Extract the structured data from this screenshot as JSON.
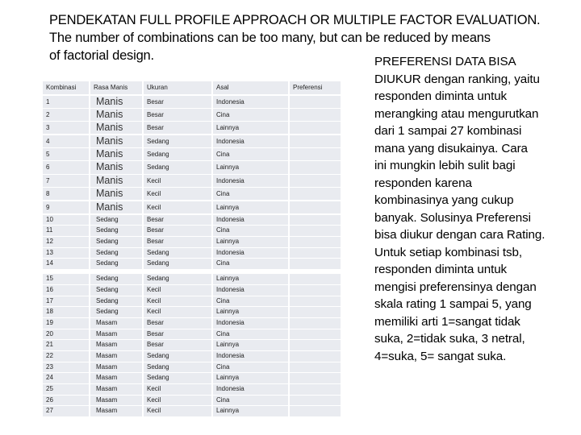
{
  "heading": {
    "lines": [
      "PENDEKATAN FULL PROFILE APPROACH OR MULTIPLE FACTOR EVALUATION.",
      "The number of combinations can be too many, but can be reduced by means",
      "of factorial design."
    ]
  },
  "description": {
    "lines": [
      "PREFERENSI DATA BISA",
      "DIUKUR dengan ranking, yaitu",
      "responden diminta untuk",
      "merangking atau mengurutkan",
      "dari 1 sampai 27 kombinasi",
      "mana yang disukainya.   Cara",
      "ini mungkin lebih sulit bagi",
      "responden karena",
      "kombinasinya yang cukup",
      "banyak. Solusinya Preferensi",
      "bisa diukur dengan cara Rating.",
      "Untuk setiap kombinasi tsb,",
      "responden diminta untuk",
      "mengisi preferensinya dengan",
      "skala rating 1 sampai 5, yang",
      "memiliki arti 1=sangat tidak",
      "suka, 2=tidak suka, 3 netral,",
      "4=suka, 5= sangat suka."
    ]
  },
  "table": {
    "headers": [
      "Kombinasi",
      "Rasa Manis",
      "Ukuran",
      "Asal",
      "Preferensi"
    ],
    "rows": [
      [
        "1",
        "Manis",
        "Besar",
        "Indonesia",
        ""
      ],
      [
        "2",
        "Manis",
        "Besar",
        "Cina",
        ""
      ],
      [
        "3",
        "Manis",
        "Besar",
        "Lainnya",
        ""
      ],
      [
        "4",
        "Manis",
        "Sedang",
        "Indonesia",
        ""
      ],
      [
        "5",
        "Manis",
        "Sedang",
        "Cina",
        ""
      ],
      [
        "6",
        "Manis",
        "Sedang",
        "Lainnya",
        ""
      ],
      [
        "7",
        "Manis",
        "Kecil",
        "Indonesia",
        ""
      ],
      [
        "8",
        "Manis",
        "Kecil",
        "Cina",
        ""
      ],
      [
        "9",
        "Manis",
        "Kecil",
        "Lainnya",
        ""
      ],
      [
        "10",
        "Sedang",
        "Besar",
        "Indonesia",
        ""
      ],
      [
        "11",
        "Sedang",
        "Besar",
        "Cina",
        ""
      ],
      [
        "12",
        "Sedang",
        "Besar",
        "Lainnya",
        ""
      ],
      [
        "13",
        "Sedang",
        "Sedang",
        "Indonesia",
        ""
      ],
      [
        "14",
        "Sedang",
        "Sedang",
        "Cina",
        ""
      ],
      [
        "15",
        "Sedang",
        "Sedang",
        "Lainnya",
        ""
      ],
      [
        "16",
        "Sedang",
        "Kecil",
        "Indonesia",
        ""
      ],
      [
        "17",
        "Sedang",
        "Kecil",
        "Cina",
        ""
      ],
      [
        "18",
        "Sedang",
        "Kecil",
        "Lainnya",
        ""
      ],
      [
        "19",
        "Masam",
        "Besar",
        "Indonesia",
        ""
      ],
      [
        "20",
        "Masam",
        "Besar",
        "Cina",
        ""
      ],
      [
        "21",
        "Masam",
        "Besar",
        "Lainnya",
        ""
      ],
      [
        "22",
        "Masam",
        "Sedang",
        "Indonesia",
        ""
      ],
      [
        "23",
        "Masam",
        "Sedang",
        "Cina",
        ""
      ],
      [
        "24",
        "Masam",
        "Sedang",
        "Lainnya",
        ""
      ],
      [
        "25",
        "Masam",
        "Kecil",
        "Indonesia",
        ""
      ],
      [
        "26",
        "Masam",
        "Kecil",
        "Cina",
        ""
      ],
      [
        "27",
        "Masam",
        "Kecil",
        "Lainnya",
        ""
      ]
    ]
  },
  "colors": {
    "cell_background": "#e9ebf0",
    "text": "#000000"
  }
}
